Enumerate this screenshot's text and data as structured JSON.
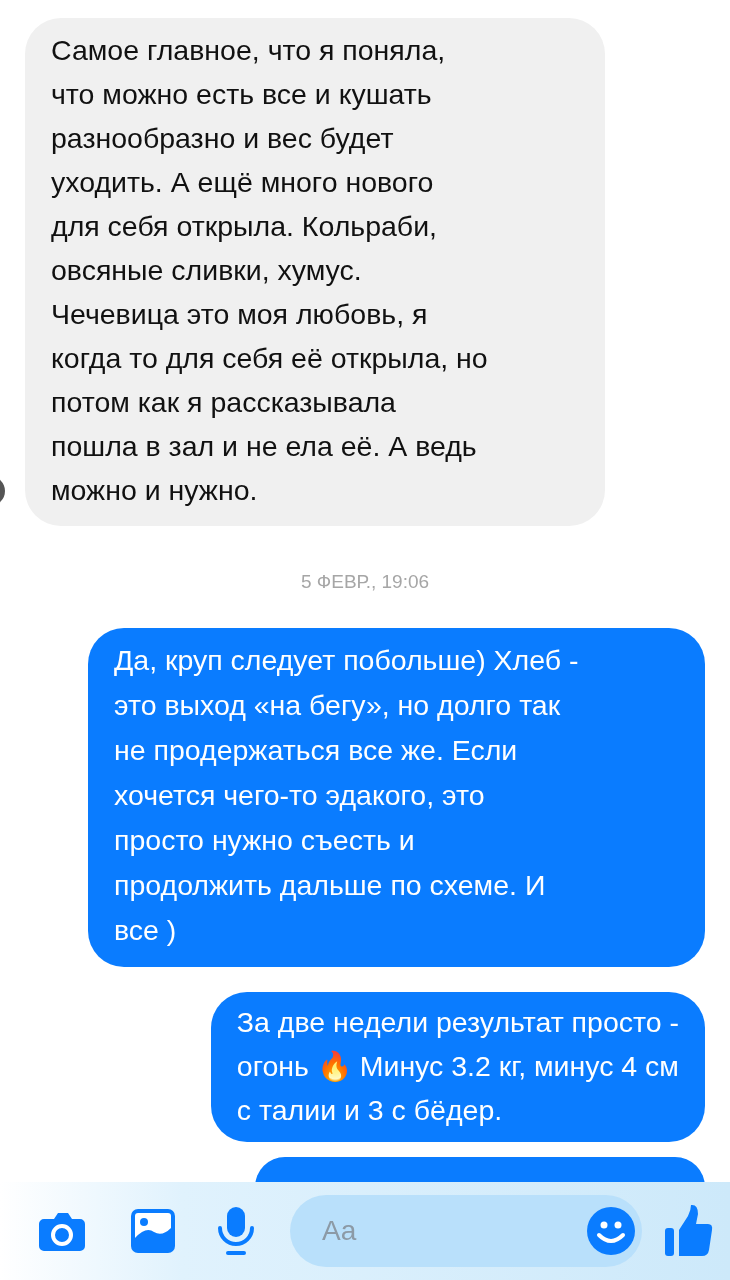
{
  "messages": [
    {
      "kind": "received",
      "text": "Самое главное, что я поняла,\nчто можно есть все и кушать\nразнообразно и вес будет\nуходить. А ещё много нового\nдля себя открыла. Кольраби,\nовсяные сливки, хумус.\nЧечевица это моя любовь, я\nкогда то для себя её открыла, но\nпотом как я рассказывала\nпошла в зал и не ела её. А ведь\nможно и нужно."
    },
    {
      "kind": "timestamp",
      "text": "5 ФЕВР., 19:06"
    },
    {
      "kind": "sent",
      "text": "Да, круп следует побольше) Хлеб -\nэто выход «на бегу», но долго так\nне продержаться все же. Если\nхочется чего-то эдакого, это\nпросто нужно съесть и\nпродолжить дальше по схеме. И\nвсе )"
    },
    {
      "kind": "sent",
      "text": "За две недели результат просто -\nогонь 🔥 Минус 3.2 кг, минус 4 см\nс талии и 3 с бёдер."
    },
    {
      "kind": "sent_partial"
    }
  ],
  "composer": {
    "placeholder": "Aa"
  }
}
